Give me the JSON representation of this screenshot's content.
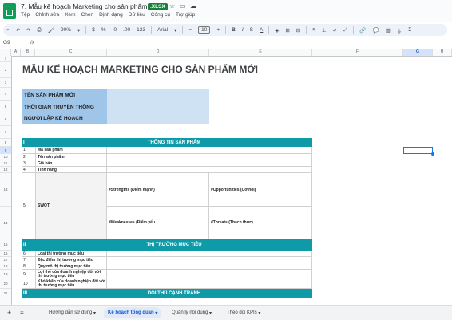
{
  "window": {
    "doc_title": "7. Mẫu kế hoạch Marketing cho sản phẩm mới",
    "file_badge": ".XLSX"
  },
  "menu": [
    "Tệp",
    "Chỉnh sửa",
    "Xem",
    "Chèn",
    "Định dạng",
    "Dữ liệu",
    "Công cụ",
    "Trợ giúp"
  ],
  "toolbar": {
    "zoom": "90%",
    "currency": "$",
    "percent": "%",
    "decimal_less": ".0",
    "decimal_more": ".00",
    "number_format": "123",
    "font": "Arial",
    "font_size": "10"
  },
  "formula_bar": {
    "name_box": "G9",
    "fx": "fx"
  },
  "columns": [
    "A",
    "B",
    "C",
    "D",
    "E",
    "F",
    "G",
    "H"
  ],
  "rows": [
    "1",
    "2",
    "3",
    "4",
    "5",
    "6",
    "7",
    "8",
    "9",
    "10",
    "11",
    "12",
    "13",
    "14",
    "15",
    "16",
    "17",
    "18",
    "19",
    "20",
    "21"
  ],
  "sheet": {
    "title": "MẪU KẾ HOẠCH MARKETING CHO SẢN PHẨM MỚI",
    "info_labels": [
      "TÊN SẢN PHẨM MỚI",
      "THỜI GIAN TRUYỀN THÔNG",
      "NGƯỜI LẬP KẾ HOẠCH"
    ],
    "section1": {
      "roman": "I",
      "title": "THÔNG TIN SẢN PHẨM",
      "items": [
        {
          "num": "1",
          "label": "Mã sản phẩm"
        },
        {
          "num": "2",
          "label": "Tên sản phẩm"
        },
        {
          "num": "3",
          "label": "Giá bán"
        },
        {
          "num": "4",
          "label": "Tính năng"
        }
      ],
      "swot": {
        "num": "5",
        "label": "SWOT",
        "strengths": "#Strengths (Điểm mạnh)",
        "opportunities": "#Opportunities (Cơ hội)",
        "weaknesses": "#Weaknesses (Điểm yếu",
        "threats": "#Threats (Thách thức)"
      }
    },
    "section2": {
      "roman": "II",
      "title": "THỊ TRƯỜNG MỤC TIÊU",
      "items": [
        {
          "num": "6",
          "label": "Loại thị trường mục tiêu"
        },
        {
          "num": "7",
          "label": "Đặc điểm thị trường mục tiêu"
        },
        {
          "num": "8",
          "label": "Quy mô thị trường mục tiêu"
        },
        {
          "num": "9",
          "label": "Lợi thế của doanh nghiệp đối với thị trường mục tiêu"
        },
        {
          "num": "10",
          "label": "Khó khăn của doanh nghiệp đối với thị trường mục tiêu"
        }
      ]
    },
    "section3": {
      "roman": "III",
      "title": "ĐỐI THỦ CẠNH TRANH"
    }
  },
  "tabs": [
    "Hướng dẫn sử dụng",
    "Kế hoạch tổng quan",
    "Quản lý nội dung",
    "Theo dõi KPIs"
  ],
  "active_tab": 1,
  "colors": {
    "teal_header": "#0e9aa7",
    "label_blue": "#9fc5e8",
    "value_blue": "#cfe2f3",
    "selection": "#1a73e8"
  }
}
